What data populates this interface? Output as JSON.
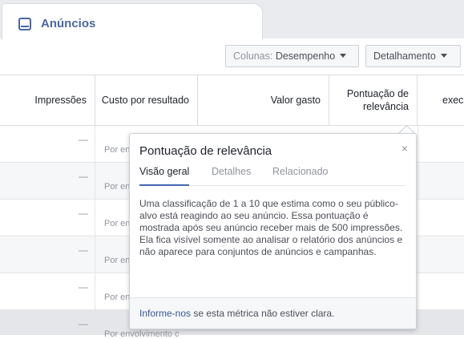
{
  "tab": {
    "title": "Anúncios",
    "icon": "ad-icon"
  },
  "toolbar": {
    "columns_label": "Colunas:",
    "columns_value": "Desempenho",
    "breakdown_label": "Detalhamento"
  },
  "table": {
    "headers": [
      "Impressões",
      "Custo por resultado",
      "Valor gasto",
      "Pontuação de relevância",
      "exec"
    ],
    "rows": [
      {
        "impressions": "—",
        "cost_label": "Por en"
      },
      {
        "impressions": "—",
        "cost_label": "Por en"
      },
      {
        "impressions": "—",
        "cost_label": "Por en"
      },
      {
        "impressions": "—",
        "cost_label": "Por en"
      },
      {
        "impressions": "—",
        "cost_label": "Por en"
      },
      {
        "impressions": "—",
        "cost_label": "Por envolvimento c"
      }
    ]
  },
  "popover": {
    "title": "Pontuação de relevância",
    "close_icon": "×",
    "tabs": [
      "Visão geral",
      "Detalhes",
      "Relacionado"
    ],
    "body": "Uma classificação de 1 a 10 que estima como o seu público-alvo está reagindo ao seu anúncio. Essa pontuação é mostrada após seu anúncio receber mais de 500 impressões. Ela fica visível somente ao analisar o relatório dos anúncios e não aparece para conjuntos de anúncios e campanhas.",
    "footer_link": "Informe-nos",
    "footer_text": " se esta métrica não estiver clara."
  },
  "colors": {
    "accent": "#4b67a1",
    "link": "#365899",
    "active_tab": "#4267b2"
  }
}
